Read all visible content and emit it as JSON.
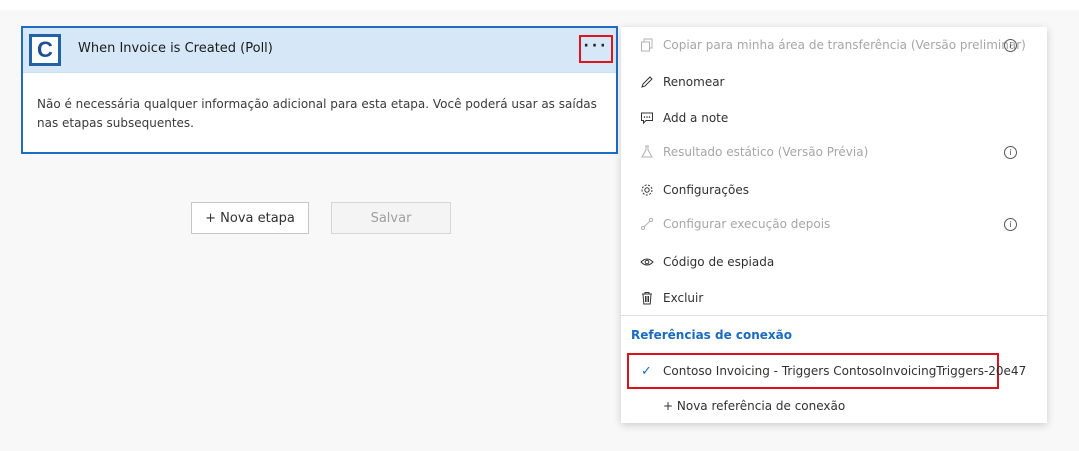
{
  "trigger": {
    "logo_letter": "C",
    "title": "When Invoice is Created (Poll)",
    "more_label": "···",
    "description": "Não é necessária qualquer informação adicional para esta etapa. Você poderá usar as saídas nas etapas subsequentes."
  },
  "actions": {
    "new_step": "+ Nova etapa",
    "save": "Salvar"
  },
  "menu": {
    "items": [
      {
        "label": "Copiar para minha área de transferência (Versão preliminar)",
        "icon": "copy-icon",
        "disabled": true,
        "info": true
      },
      {
        "label": "Renomear",
        "icon": "pencil-icon",
        "disabled": false,
        "info": false
      },
      {
        "label": "Add a note",
        "icon": "comment-icon",
        "disabled": false,
        "info": false
      },
      {
        "label": "Resultado estático (Versão Prévia)",
        "icon": "flask-icon",
        "disabled": true,
        "info": true
      },
      {
        "label": "Configurações",
        "icon": "gear-icon",
        "disabled": false,
        "info": false
      },
      {
        "label": "Configurar execução depois",
        "icon": "run-after-icon",
        "disabled": true,
        "info": true
      },
      {
        "label": "Código de espiada",
        "icon": "eye-icon",
        "disabled": false,
        "info": false
      },
      {
        "label": "Excluir",
        "icon": "trash-icon",
        "disabled": false,
        "info": false
      }
    ],
    "info_glyph": "i",
    "connection_section_title": "Referências de conexão",
    "connection_selected": "Contoso Invoicing - Triggers ContosoInvoicingTriggers-20e47",
    "new_connection": "+ Nova referência de conexão"
  },
  "colors": {
    "accent": "#1f6cc4",
    "highlight": "#e0141e",
    "header_bg": "#d6e8f8"
  }
}
